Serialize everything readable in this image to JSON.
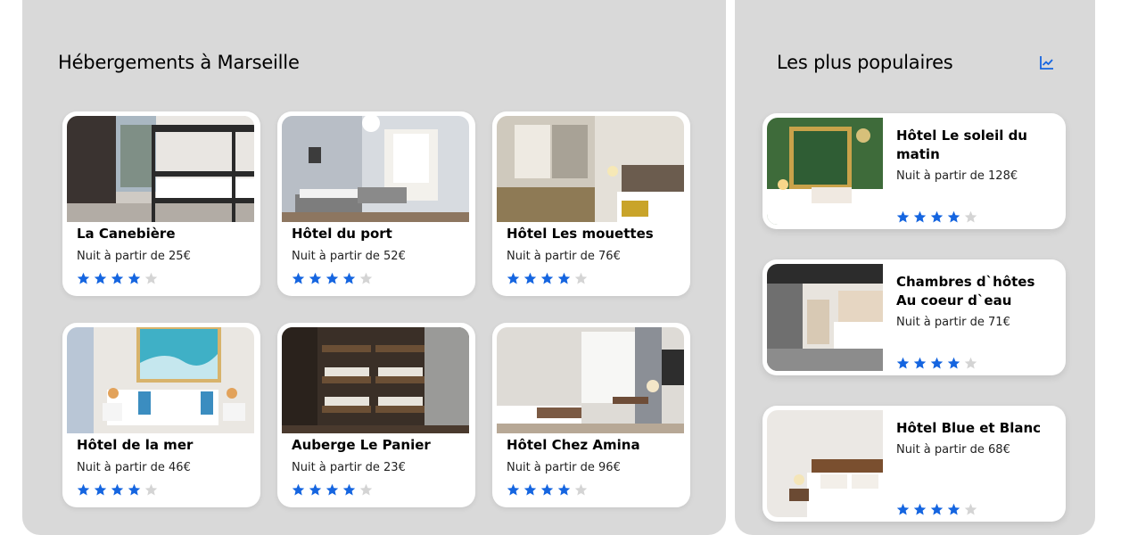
{
  "main": {
    "title": "Hébergements à Marseille",
    "cards": [
      {
        "name": "La Canebière",
        "price": "Nuit à partir de 25€",
        "rating": 4
      },
      {
        "name": "Hôtel du port",
        "price": "Nuit à partir de 52€",
        "rating": 4
      },
      {
        "name": "Hôtel Les mouettes",
        "price": "Nuit à partir de 76€",
        "rating": 4
      },
      {
        "name": "Hôtel de la mer",
        "price": "Nuit à partir de 46€",
        "rating": 4
      },
      {
        "name": "Auberge Le Panier",
        "price": "Nuit à partir de 23€",
        "rating": 4
      },
      {
        "name": "Hôtel Chez Amina",
        "price": "Nuit à partir de 96€",
        "rating": 4
      }
    ]
  },
  "sidebar": {
    "title": "Les plus populaires",
    "icon": "trending-chart-icon",
    "items": [
      {
        "name": "Hôtel Le soleil du matin",
        "price": "Nuit à partir de 128€",
        "rating": 4
      },
      {
        "name": "Chambres d`hôtes Au coeur d`eau",
        "price": "Nuit à partir de 71€",
        "rating": 4
      },
      {
        "name": "Hôtel Blue et Blanc",
        "price": "Nuit à partir de 68€",
        "rating": 4
      }
    ]
  },
  "colors": {
    "panel": "#d9d9d9",
    "star_filled": "#1565e0",
    "star_empty": "#d4d4d4",
    "accent": "#1565e0"
  },
  "rating_max": 5
}
